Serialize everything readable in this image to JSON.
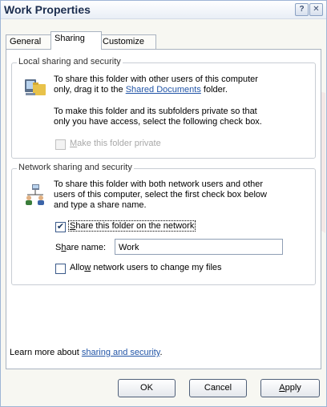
{
  "window": {
    "title": "Work Properties",
    "help_label": "?",
    "close_label": "✕"
  },
  "tabs": [
    {
      "label": "General",
      "active": false
    },
    {
      "label": "Sharing",
      "active": true
    },
    {
      "label": "Customize",
      "active": false
    }
  ],
  "local": {
    "legend": "Local sharing and security",
    "text_line1": "To share this folder with other users of this computer",
    "text_line2_prefix": "only, drag it to the ",
    "text_line2_link": "Shared Documents",
    "text_line2_suffix": " folder.",
    "private_text_line1": "To make this folder and its subfolders private so that",
    "private_text_line2": "only you have access, select the following check box.",
    "make_private_label_mnemonic": "M",
    "make_private_label_rest": "ake this folder private",
    "make_private_checked": false,
    "icon": "computer-folder-icon"
  },
  "network": {
    "legend": "Network sharing and security",
    "text_line1": "To share this folder with both network users and other",
    "text_line2": "users of this computer, select the first check box below",
    "text_line3": "and type a share name.",
    "share_label_mnemonic": "S",
    "share_label_rest": "hare this folder on the network",
    "share_checked": true,
    "share_name_label_prefix": "S",
    "share_name_label_mnemonic": "h",
    "share_name_label_rest": "are name:",
    "share_name_value": "Work",
    "allow_label_prefix": "Allo",
    "allow_label_mnemonic": "w",
    "allow_label_rest": " network users to change my files",
    "allow_checked": false,
    "icon": "network-users-icon"
  },
  "footer": {
    "learn_prefix": "Learn more about ",
    "learn_link": "sharing and security",
    "learn_suffix": "."
  },
  "buttons": {
    "ok": "OK",
    "cancel": "Cancel",
    "apply_mnemonic": "A",
    "apply_rest": "pply"
  }
}
